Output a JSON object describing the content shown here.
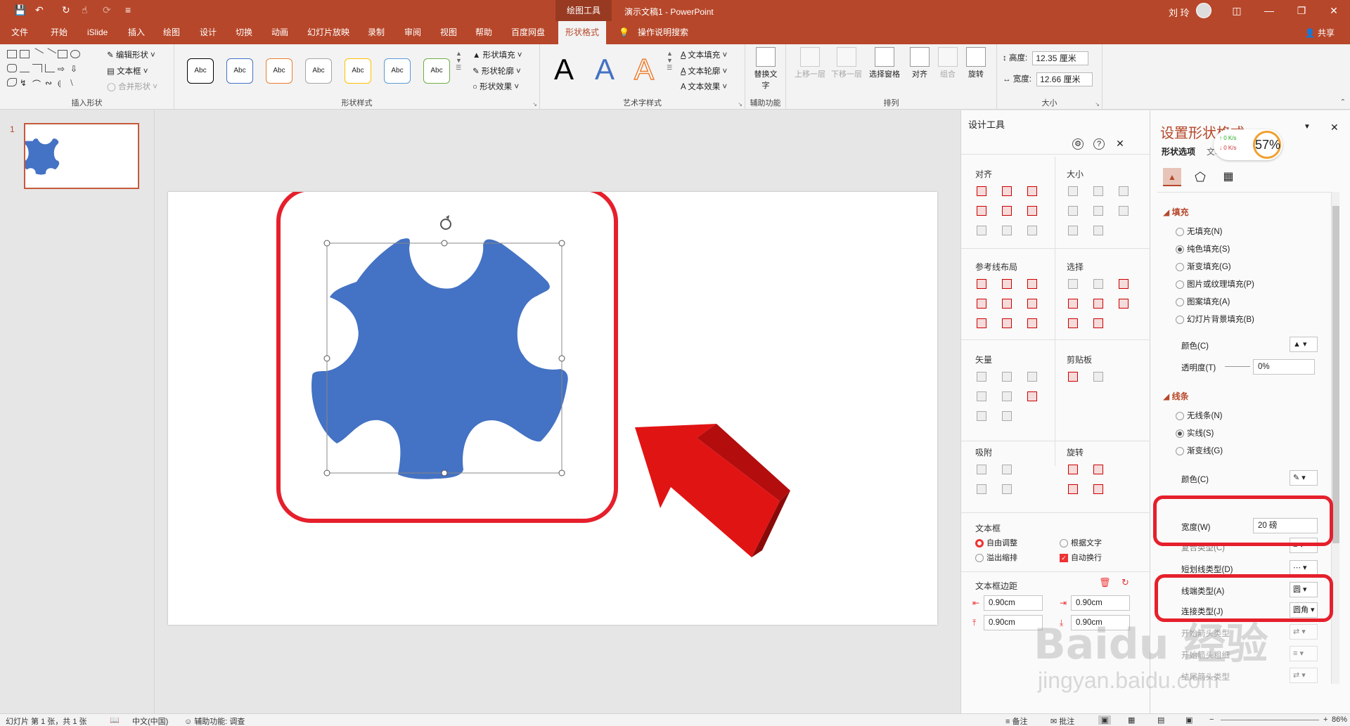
{
  "app": {
    "context_tab_title": "绘图工具",
    "document_title": "演示文稿1  -  PowerPoint",
    "user_name": "刘 玲"
  },
  "tabs": [
    "文件",
    "开始",
    "iSlide",
    "插入",
    "绘图",
    "设计",
    "切换",
    "动画",
    "幻灯片放映",
    "录制",
    "审阅",
    "视图",
    "帮助",
    "百度网盘",
    "形状格式"
  ],
  "tell_me": "操作说明搜索",
  "share": "共享",
  "ribbon": {
    "insert_shapes": {
      "label": "插入形状",
      "edit_shape": "编辑形状",
      "text_box": "文本框",
      "merge_shapes": "合并形状"
    },
    "shape_styles": {
      "label": "形状样式",
      "sample": "Abc",
      "fill": "形状填充",
      "outline": "形状轮廓",
      "effects": "形状效果",
      "colors": [
        "#000000",
        "#4472c4",
        "#ed7d31",
        "#a5a5a5",
        "#ffc000",
        "#5b9bd5",
        "#70ad47"
      ]
    },
    "wordart": {
      "label": "艺术字样式",
      "letter": "A",
      "text_fill": "文本填充",
      "text_outline": "文本轮廓",
      "text_effects": "文本效果"
    },
    "accessibility": {
      "label": "辅助功能",
      "alt_text": "替换文字"
    },
    "arrange": {
      "label": "排列",
      "bring_forward": "上移一层",
      "send_backward": "下移一层",
      "selection_pane": "选择窗格",
      "align": "对齐",
      "group": "组合",
      "rotate": "旋转"
    },
    "size": {
      "label": "大小",
      "height_label": "高度:",
      "height": "12.35 厘米",
      "width_label": "宽度:",
      "width": "12.66 厘米"
    }
  },
  "thumb": {
    "number": "1"
  },
  "design_pane": {
    "title": "设计工具",
    "sections": {
      "align": "对齐",
      "size": "大小",
      "guides": "参考线布局",
      "select": "选择",
      "vector": "矢量",
      "clipboard": "剪贴板",
      "snap": "吸附",
      "rotate": "旋转",
      "textbox": "文本框",
      "margins": "文本框边距"
    },
    "textbox_options": {
      "free": "自由调整",
      "fit_text": "根据文字",
      "overflow": "溢出缩排",
      "wrap": "自动换行"
    },
    "margins": {
      "left": "0.90cm",
      "right": "0.90cm",
      "top": "0.90cm",
      "bottom": "0.90cm"
    }
  },
  "format_pane": {
    "title": "设置形状格式",
    "tab_shape": "形状选项",
    "tab_text": "文本选项",
    "fill_section": "填充",
    "fill_options": [
      "无填充(N)",
      "纯色填充(S)",
      "渐变填充(G)",
      "图片或纹理填充(P)",
      "图案填充(A)",
      "幻灯片背景填充(B)"
    ],
    "fill_selected": 1,
    "color_label": "颜色(C)",
    "transparency_label": "透明度(T)",
    "transparency": "0%",
    "line_section": "线条",
    "line_options": [
      "无线条(N)",
      "实线(S)",
      "渐变线(G)"
    ],
    "line_selected": 1,
    "line_color_label": "颜色(C)",
    "line_width_label": "宽度(W)",
    "line_width": "20 磅",
    "compound_label": "复合类型(C)",
    "dash_label": "短划线类型(D)",
    "cap_label": "线端类型(A)",
    "cap_value": "圆",
    "join_label": "连接类型(J)",
    "join_value": "圆角",
    "begin_arrow_label": "开始箭头类型",
    "begin_arrow_size_label": "开始箭头粗细",
    "end_arrow_label": "结尾箭头类型"
  },
  "net_widget": {
    "up": "0  K/s",
    "down": "0  K/s",
    "percent": "57%"
  },
  "status": {
    "slide_info": "幻灯片 第 1 张，共 1 张",
    "language": "中文(中国)",
    "accessibility": "辅助功能: 调查",
    "notes": "备注",
    "comments": "批注",
    "zoom": "86%"
  },
  "watermark": {
    "line1": "Baidu 经验",
    "line2": "jingyan.baidu.com"
  },
  "colors": {
    "accent": "#b7472a",
    "shape_fill": "#4472c4",
    "highlight": "#e5202c"
  }
}
